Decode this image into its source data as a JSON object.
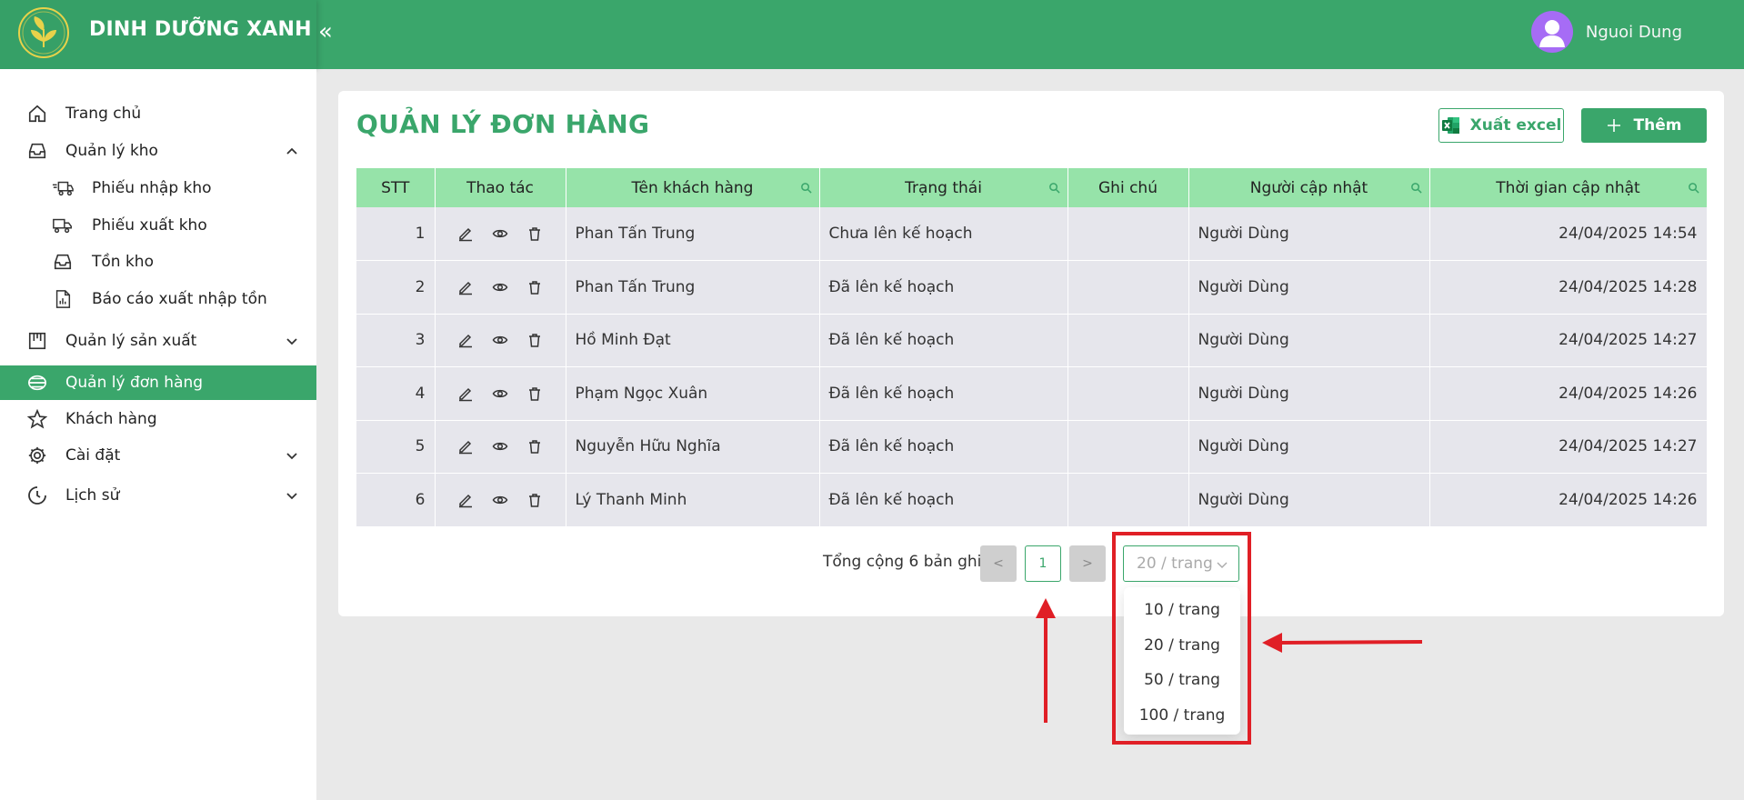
{
  "app": {
    "brand_name": "DINH DƯỠNG XANH",
    "user_name": "Nguoi Dung",
    "accent_color": "#3aa66b"
  },
  "sidebar": {
    "items": [
      {
        "label": "Trang chủ",
        "icon": "home-icon"
      },
      {
        "label": "Quản lý kho",
        "icon": "inbox-icon",
        "expanded": true
      },
      {
        "label": "Phiếu nhập kho",
        "icon": "truck-in-icon"
      },
      {
        "label": "Phiếu xuất kho",
        "icon": "truck-out-icon"
      },
      {
        "label": "Tồn kho",
        "icon": "inbox-icon"
      },
      {
        "label": "Báo cáo xuất nhập tồn",
        "icon": "report-icon"
      },
      {
        "label": "Quản lý sản xuất",
        "icon": "factory-icon"
      },
      {
        "label": "Quản lý đơn hàng",
        "icon": "order-icon",
        "active": true
      },
      {
        "label": "Khách hàng",
        "icon": "star-icon"
      },
      {
        "label": "Cài đặt",
        "icon": "gear-icon"
      },
      {
        "label": "Lịch sử",
        "icon": "clock-icon"
      }
    ]
  },
  "main": {
    "title": "QUẢN LÝ ĐƠN HÀNG",
    "export_label": "Xuất excel",
    "add_label": "Thêm"
  },
  "table": {
    "columns": [
      "STT",
      "Thao tác",
      "Tên khách hàng",
      "Trạng thái",
      "Ghi chú",
      "Người cập nhật",
      "Thời gian cập nhật"
    ],
    "rows": [
      {
        "stt": "1",
        "customer": "Phan Tấn Trung",
        "status": "Chưa lên kế hoạch",
        "note": "",
        "updated_by": "Người Dùng",
        "updated_at": "24/04/2025 14:54"
      },
      {
        "stt": "2",
        "customer": "Phan Tấn Trung",
        "status": "Đã lên kế hoạch",
        "note": "",
        "updated_by": "Người Dùng",
        "updated_at": "24/04/2025 14:28"
      },
      {
        "stt": "3",
        "customer": "Hồ Minh Đạt",
        "status": "Đã lên kế hoạch",
        "note": "",
        "updated_by": "Người Dùng",
        "updated_at": "24/04/2025 14:27"
      },
      {
        "stt": "4",
        "customer": "Phạm Ngọc Xuân",
        "status": "Đã lên kế hoạch",
        "note": "",
        "updated_by": "Người Dùng",
        "updated_at": "24/04/2025 14:26"
      },
      {
        "stt": "5",
        "customer": "Nguyễn Hữu Nghĩa",
        "status": "Đã lên kế hoạch",
        "note": "",
        "updated_by": "Người Dùng",
        "updated_at": "24/04/2025 14:27"
      },
      {
        "stt": "6",
        "customer": "Lý Thanh Minh",
        "status": "Đã lên kế hoạch",
        "note": "",
        "updated_by": "Người Dùng",
        "updated_at": "24/04/2025 14:26"
      }
    ]
  },
  "pagination": {
    "total_text": "Tổng cộng 6 bản ghi",
    "prev": "<",
    "current_page": "1",
    "next": ">",
    "page_size": "20 / trang",
    "options": [
      "10 / trang",
      "20 / trang",
      "50 / trang",
      "100 / trang"
    ]
  }
}
